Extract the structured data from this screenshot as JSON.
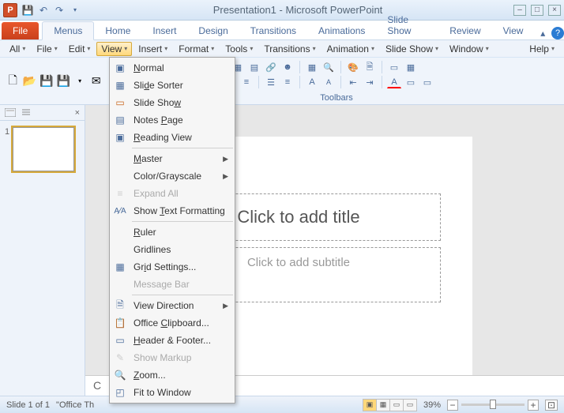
{
  "window": {
    "title": "Presentation1 - Microsoft PowerPoint"
  },
  "tabs": {
    "file": "File",
    "menus": "Menus",
    "home": "Home",
    "insert": "Insert",
    "design": "Design",
    "transitions": "Transitions",
    "animations": "Animations",
    "slideshow": "Slide Show",
    "review": "Review",
    "view": "View"
  },
  "menubar": {
    "all": "All",
    "file": "File",
    "edit": "Edit",
    "view": "View",
    "insert": "Insert",
    "format": "Format",
    "tools": "Tools",
    "transitions": "Transitions",
    "animation": "Animation",
    "slideshow": "Slide Show",
    "window": "Window",
    "help": "Help"
  },
  "ribbon": {
    "toolbars_label": "Toolbars"
  },
  "view_menu": {
    "normal": "Normal",
    "slide_sorter": "Slide Sorter",
    "slide_show": "Slide Show",
    "notes_page": "Notes Page",
    "reading_view": "Reading View",
    "master": "Master",
    "color_grayscale": "Color/Grayscale",
    "expand_all": "Expand All",
    "show_text_formatting": "Show Text Formatting",
    "ruler": "Ruler",
    "gridlines": "Gridlines",
    "grid_settings": "Grid Settings...",
    "message_bar": "Message Bar",
    "view_direction": "View Direction",
    "office_clipboard": "Office Clipboard...",
    "header_footer": "Header & Footer...",
    "show_markup": "Show Markup",
    "zoom": "Zoom...",
    "fit_to_window": "Fit to Window"
  },
  "slide": {
    "title_placeholder": "Click to add title",
    "subtitle_placeholder": "Click to add subtitle",
    "thumb_num": "1"
  },
  "notes": {
    "prefix": "C"
  },
  "status": {
    "slide": "Slide 1 of 1",
    "theme": "\"Office Th",
    "zoom": "39%"
  }
}
